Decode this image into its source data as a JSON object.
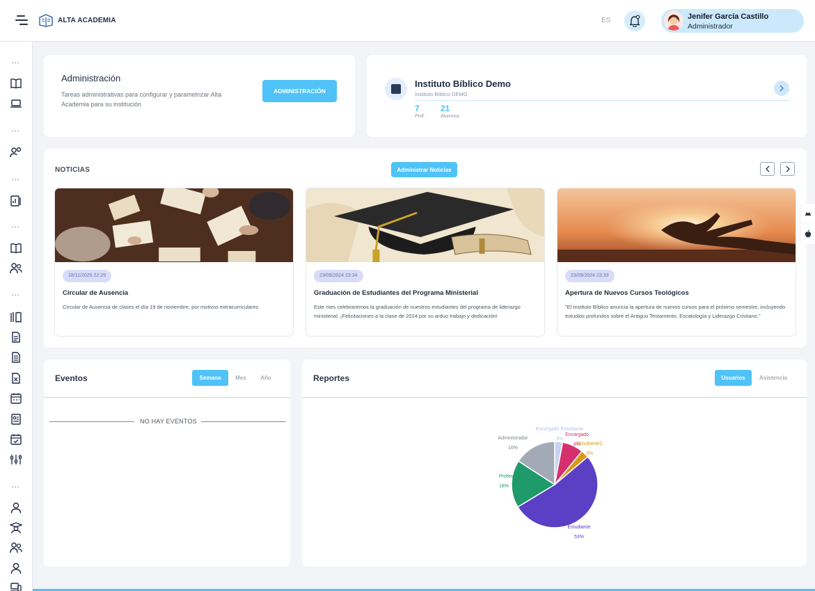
{
  "topbar": {
    "app_name": "ALTA ACADEMIA",
    "language": "ES",
    "user_name": "Jenifer García Castillo",
    "user_role": "Administrador"
  },
  "admin_card": {
    "title": "Administración",
    "description": "Tareas administrativas para configurar y parametrizar Alta Academia para su institución",
    "button_label": "ADMINISTRACIÓN"
  },
  "institution": {
    "name": "Instituto Bíblico Demo",
    "subtitle": "Instituto Bíblico DEMO",
    "professors_count": "7",
    "professors_label": "Prof.",
    "students_count": "21",
    "students_label": "Alumnos"
  },
  "news": {
    "title": "NOTICIAS",
    "manage_label": "Administrar Noticias",
    "items": [
      {
        "date": "18/11/2025 22:29",
        "title": "Circular de Ausencia",
        "body": "Circular de Ausencia de clases el día 19 de noviembre, por motivos extracurriculares"
      },
      {
        "date": "23/09/2024 23:34",
        "title": "Graduación de Estudiantes del Programa Ministerial",
        "body": "Este mes celebraremos la graduación de nuestros estudiantes del programa de liderazgo ministerial. ¡Felicitaciones a la clase de 2024 por su arduo trabajo y dedicación!"
      },
      {
        "date": "23/09/2024 23:33",
        "title": "Apertura de Nuevos Cursos Teológicos",
        "body": "\"El Instituto Bíblico anuncia la apertura de nuevos cursos para el próximo semestre, incluyendo estudios profundos sobre el Antiguo Testamento, Escatología y Liderazgo Cristiano.\""
      }
    ]
  },
  "events": {
    "title": "Eventos",
    "tabs": [
      "Semana",
      "Mes",
      "Año"
    ],
    "active_tab": "Semana",
    "empty_text": "NO HAY EVENTOS"
  },
  "reports": {
    "title": "Reportes",
    "tabs": [
      "Usuarios",
      "Asistencia"
    ],
    "active_tab": "Usuarios"
  },
  "chart_data": {
    "type": "pie",
    "labels": [
      "Estudiante",
      "Profesor",
      "Administrador",
      "Encargado Estudiante",
      "Encargado",
      "Estudiante2"
    ],
    "values": [
      53,
      18,
      16,
      3,
      8,
      3
    ],
    "value_labels": [
      "53%",
      "18%",
      "16%",
      "3%",
      "8%",
      "3%"
    ],
    "colors": [
      "#5b3fc4",
      "#1f9a6b",
      "#a3aab7",
      "#c7d2f0",
      "#d62f6e",
      "#d99a1a"
    ]
  },
  "colors": {
    "accent": "#4fc3f7",
    "date_badge": "#d9dcf7"
  },
  "sidebar_icons": [
    "book-icon",
    "laptop-icon",
    "users-settings-icon",
    "report-icon",
    "book-open-icon",
    "group-icon",
    "library-icon",
    "document-icon",
    "document-list-icon",
    "excel-icon",
    "calendar-icon",
    "id-card-icon",
    "calendar-check-icon",
    "settings-sliders-icon",
    "user-icon",
    "graduate-icon",
    "team-icon",
    "person-icon",
    "devices-icon"
  ]
}
